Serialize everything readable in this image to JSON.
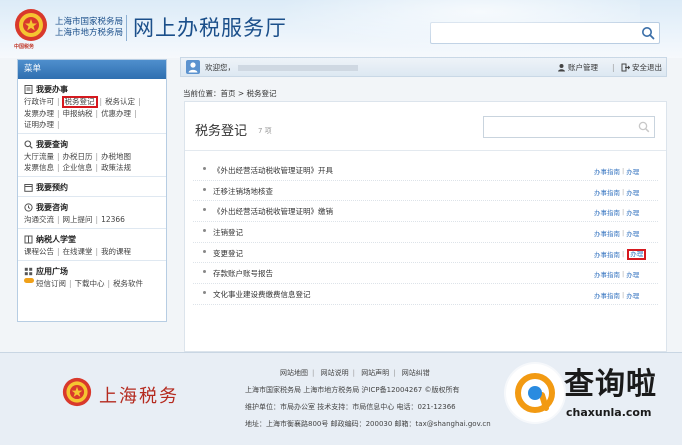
{
  "header": {
    "emblem_caption": "中国税务",
    "office_1": "上海市国家税务局",
    "office_2": "上海市地方税务局",
    "site_title": "网上办税服务厅"
  },
  "sidebar": {
    "menu_label": "菜单",
    "sections": [
      {
        "title": "我要办事",
        "links": [
          "行政许可",
          "税务登记",
          "税务认定",
          "发票办理",
          "申报纳税",
          "优惠办理",
          "证明办理"
        ]
      },
      {
        "title": "我要查询",
        "links": [
          "大厅流量",
          "办税日历",
          "办税地图",
          "发票信息",
          "企业信息",
          "政策法规"
        ]
      },
      {
        "title": "我要预约",
        "links": []
      },
      {
        "title": "我要咨询",
        "links": [
          "沟通交流",
          "网上提问",
          "12366"
        ]
      },
      {
        "title": "纳税人学堂",
        "links": [
          "课程公告",
          "在线课堂",
          "我的课程"
        ]
      },
      {
        "title": "应用广场",
        "links": [
          "短信订阅",
          "下载中心",
          "税务软件"
        ]
      }
    ]
  },
  "topbar": {
    "welcome": "欢迎您，",
    "account": "账户管理",
    "logout": "安全退出"
  },
  "breadcrumb": "当前位置：首页 > 税务登记",
  "panel": {
    "title": "税务登记",
    "count": "7 项",
    "tasks": [
      {
        "name": "《外出经营活动税收管理证明》开具",
        "guide": "办事指南",
        "action": "办理"
      },
      {
        "name": "迁移注销场地核查",
        "guide": "办事指南",
        "action": "办理"
      },
      {
        "name": "《外出经营活动税收管理证明》缴销",
        "guide": "办事指南",
        "action": "办理"
      },
      {
        "name": "注销登记",
        "guide": "办事指南",
        "action": "办理"
      },
      {
        "name": "变更登记",
        "guide": "办事指南",
        "action": "办理"
      },
      {
        "name": "存款账户账号报告",
        "guide": "办事指南",
        "action": "办理"
      },
      {
        "name": "文化事业建设费缴费信息登记",
        "guide": "办事指南",
        "action": "办理"
      }
    ]
  },
  "footer": {
    "brand": "上海税务",
    "links": [
      "网站地图",
      "网站说明",
      "网站声明",
      "网站纠错"
    ],
    "line_1": "上海市国家税务局 上海市地方税务局 沪ICP备12004267 ©版权所有",
    "line_2": "维护单位：市局办公室  技术支持：市局信息中心 电话：021-12366",
    "line_3": "地址：上海市衡襄路800号  邮政编码：200030  邮箱：tax@shanghai.gov.cn"
  },
  "watermark": {
    "text": "查询啦",
    "url": "chaxunla.com"
  }
}
